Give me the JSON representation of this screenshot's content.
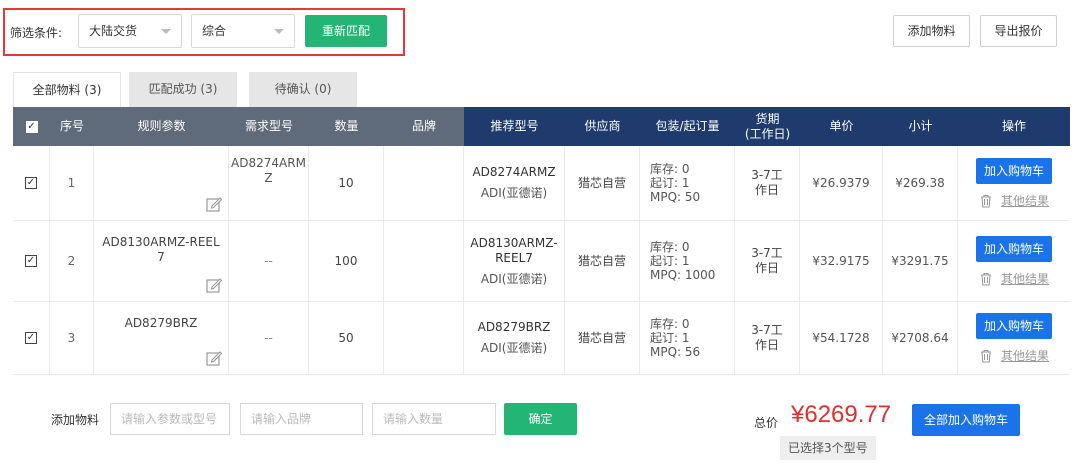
{
  "filter": {
    "label": "筛选条件:",
    "delivery_value": "大陆交货",
    "sort_value": "综合",
    "rematch_label": "重新匹配"
  },
  "toolbar": {
    "add_material_label": "添加物料",
    "export_quote_label": "导出报价"
  },
  "tabs": [
    {
      "label": "全部物料 (3)",
      "active": true
    },
    {
      "label": "匹配成功 (3)",
      "active": false
    },
    {
      "label": "待确认 (0)",
      "active": false
    }
  ],
  "table": {
    "headers": {
      "seq": "序号",
      "spec": "规则参数",
      "req_model": "需求型号",
      "qty": "数量",
      "brand": "品牌",
      "rec_model": "推荐型号",
      "supplier": "供应商",
      "package": "包装/起订量",
      "delivery_line1": "货期",
      "delivery_line2": "(工作日)",
      "price": "单价",
      "subtotal": "小计",
      "action": "操作"
    },
    "rows": [
      {
        "seq": "1",
        "spec": "",
        "req_model": "AD8274ARMZ",
        "qty": "10",
        "brand": "",
        "rec_model": "AD8274ARMZ",
        "rec_brand": "ADI(亚德诺)",
        "supplier": "猎芯自营",
        "stock": "库存: 0",
        "moq": "起订: 1",
        "mpq": "MPQ: 50",
        "delivery": "3-7工作日",
        "price": "¥26.9379",
        "subtotal": "¥269.38",
        "add_cart": "加入购物车",
        "other_results": "其他结果"
      },
      {
        "seq": "2",
        "spec": "AD8130ARMZ-REEL7",
        "req_model": "--",
        "qty": "100",
        "brand": "",
        "rec_model": "AD8130ARMZ-REEL7",
        "rec_brand": "ADI(亚德诺)",
        "supplier": "猎芯自营",
        "stock": "库存: 0",
        "moq": "起订: 1",
        "mpq": "MPQ: 1000",
        "delivery": "3-7工作日",
        "price": "¥32.9175",
        "subtotal": "¥3291.75",
        "add_cart": "加入购物车",
        "other_results": "其他结果"
      },
      {
        "seq": "3",
        "spec": "AD8279BRZ",
        "req_model": "--",
        "qty": "50",
        "brand": "",
        "rec_model": "AD8279BRZ",
        "rec_brand": "ADI(亚德诺)",
        "supplier": "猎芯自营",
        "stock": "库存: 0",
        "moq": "起订: 1",
        "mpq": "MPQ: 56",
        "delivery": "3-7工作日",
        "price": "¥54.1728",
        "subtotal": "¥2708.64",
        "add_cart": "加入购物车",
        "other_results": "其他结果"
      }
    ]
  },
  "add_form": {
    "label": "添加物料",
    "model_placeholder": "请输入参数或型号",
    "brand_placeholder": "请输入品牌",
    "qty_placeholder": "请输入数量",
    "confirm_label": "确定"
  },
  "summary": {
    "total_label": "总价",
    "total_value": "¥6269.77",
    "add_all_label": "全部加入购物车",
    "selected_note": "已选择3个型号"
  },
  "colors": {
    "green": "#22b573",
    "blue": "#1a73e8",
    "header_dark": "#1f3b6e",
    "header_gray": "#5f6a7a",
    "total_red": "#e0302b",
    "highlight_red": "#e53935"
  }
}
